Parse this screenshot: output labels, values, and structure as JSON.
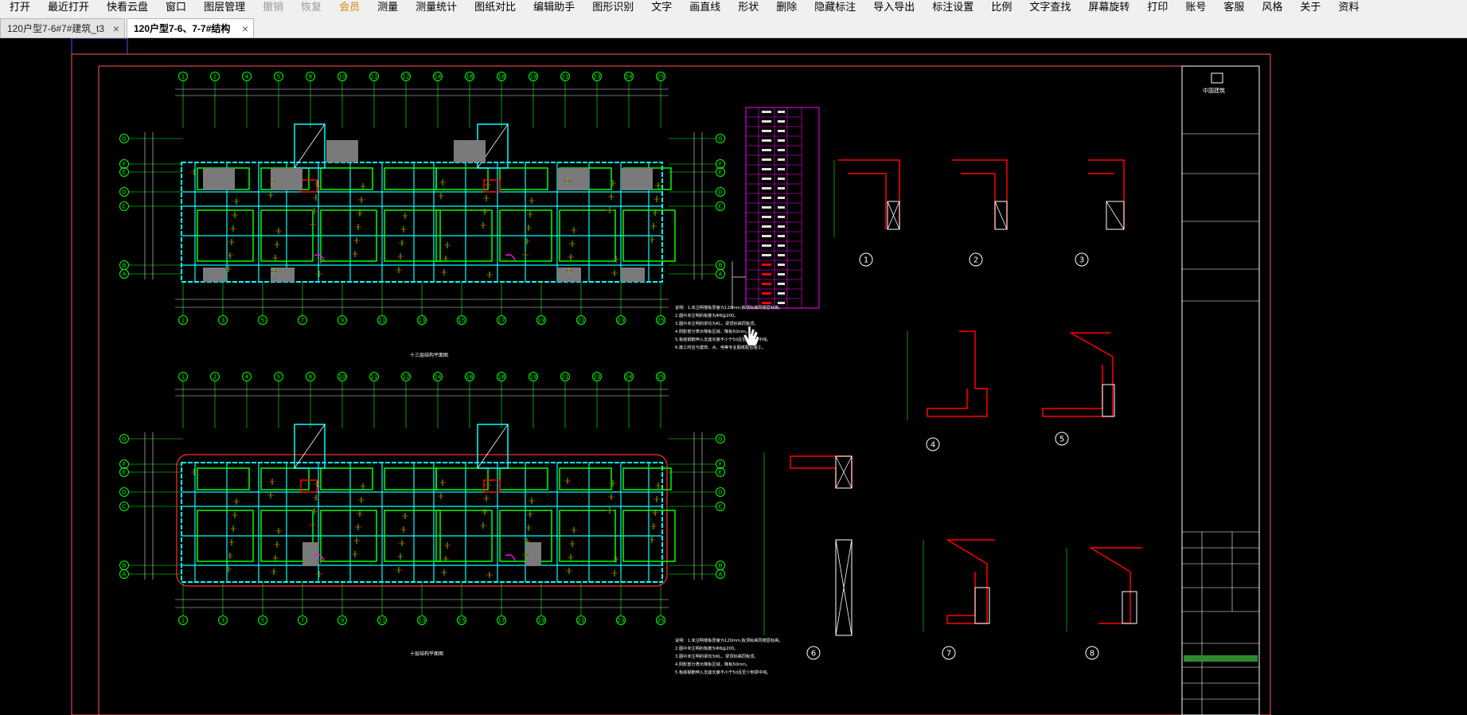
{
  "menu": [
    {
      "label": "打开",
      "state": "normal"
    },
    {
      "label": "最近打开",
      "state": "normal"
    },
    {
      "label": "快看云盘",
      "state": "normal"
    },
    {
      "label": "窗口",
      "state": "normal"
    },
    {
      "label": "图层管理",
      "state": "normal"
    },
    {
      "label": "撤销",
      "state": "disabled"
    },
    {
      "label": "恢复",
      "state": "disabled"
    },
    {
      "label": "会员",
      "state": "vip"
    },
    {
      "label": "测量",
      "state": "normal"
    },
    {
      "label": "测量统计",
      "state": "normal"
    },
    {
      "label": "图纸对比",
      "state": "normal"
    },
    {
      "label": "编辑助手",
      "state": "normal"
    },
    {
      "label": "图形识别",
      "state": "normal"
    },
    {
      "label": "文字",
      "state": "normal"
    },
    {
      "label": "画直线",
      "state": "normal"
    },
    {
      "label": "形状",
      "state": "normal"
    },
    {
      "label": "删除",
      "state": "normal"
    },
    {
      "label": "隐藏标注",
      "state": "normal"
    },
    {
      "label": "导入导出",
      "state": "normal"
    },
    {
      "label": "标注设置",
      "state": "normal"
    },
    {
      "label": "比例",
      "state": "normal"
    },
    {
      "label": "文字查找",
      "state": "normal"
    },
    {
      "label": "屏幕旋转",
      "state": "normal"
    },
    {
      "label": "打印",
      "state": "normal"
    },
    {
      "label": "账号",
      "state": "normal"
    },
    {
      "label": "客服",
      "state": "normal"
    },
    {
      "label": "风格",
      "state": "normal"
    },
    {
      "label": "关于",
      "state": "normal"
    },
    {
      "label": "资料",
      "state": "normal"
    }
  ],
  "tabs": [
    {
      "label": "120户型7-6#7#建筑_t3",
      "active": false
    },
    {
      "label": "120户型7-6、7-7#结构",
      "active": true
    }
  ],
  "tab_close_glyph": "×",
  "drawing": {
    "top_axis_labels": [
      "1",
      "2",
      "4",
      "5",
      "8",
      "10",
      "11",
      "12",
      "14",
      "16",
      "18",
      "19",
      "21",
      "23",
      "24",
      "25"
    ],
    "bottom_axis_labels": [
      "1",
      "3",
      "5",
      "7",
      "9",
      "11",
      "13",
      "15",
      "17",
      "19",
      "21",
      "23",
      "25"
    ],
    "row_axis_labels": [
      "G",
      "F",
      "E",
      "D",
      "C",
      "B",
      "A"
    ],
    "plan_top_caption": "十三层结构平面图",
    "plan_bottom_caption": "十层结构平面图",
    "detail_numbers": [
      "1",
      "2",
      "3",
      "4",
      "5",
      "6",
      "7",
      "8"
    ],
    "title_block_logo_text": "中国建筑",
    "notes_top": [
      "说明：1.未注明楼板厚度为120mm,板顶标高同楼层标高。",
      "2.图中未注明的板筋为Φ8@200。",
      "3.图中未注明的梁均为KL，梁顶标高同板顶。",
      "4.阴影部分表示降板区域，降板50mm。",
      "5.板底钢筋伸入支座长度不小于5d且至少到梁中线。",
      "6.施工时应与建筑、水、电等专业图纸配合施工。"
    ],
    "notes_bottom": [
      "说明：1.未注明楼板厚度为120mm,板顶标高同楼层标高。",
      "2.图中未注明的板筋为Φ8@200。",
      "3.图中未注明的梁均为KL，梁顶标高同板顶。",
      "4.阴影部分表示降板区域，降板50mm。",
      "5.板底钢筋伸入支座长度不小于5d且至少到梁中线。"
    ],
    "colors": {
      "line_green": "#00ff00",
      "line_cyan": "#00ffff",
      "line_red": "#ff0000",
      "line_white": "#ffffff",
      "line_magenta": "#ff00ff",
      "dim_white": "#e0e0e0",
      "hatch_gray": "#7a7a7a"
    }
  }
}
